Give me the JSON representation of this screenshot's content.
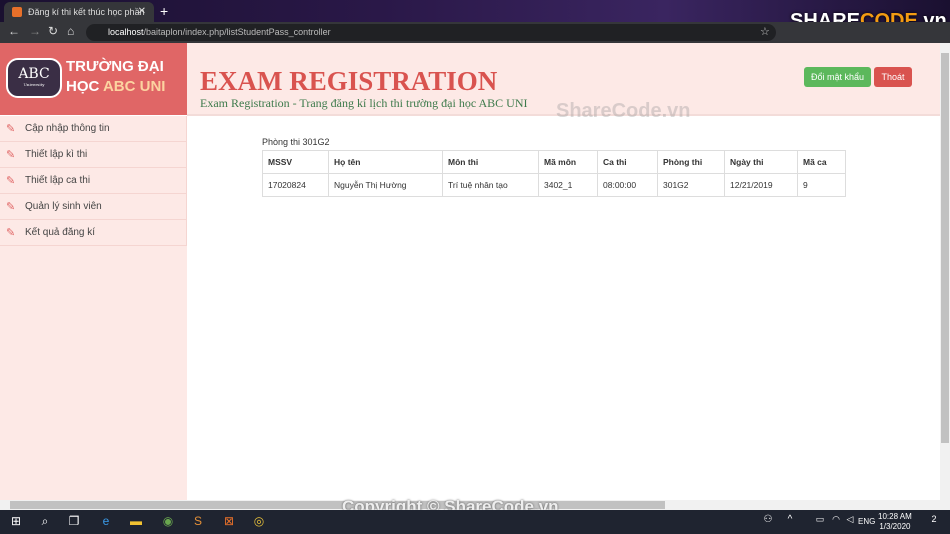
{
  "browser": {
    "tab_title": "Đăng kí thi kết thúc học phần",
    "url_host": "localhost",
    "url_path": "/baitaplon/index.php/listStudentPass_controller"
  },
  "brand": {
    "logo_text": "ABC",
    "logo_sub": "University",
    "line1": "TRƯỜNG ĐẠI",
    "line2a": "HỌC ",
    "line2b": "ABC UNI"
  },
  "header": {
    "title": "EXAM REGISTRATION",
    "subtitle": "Exam Registration - Trang đăng kí lịch thi trường đại học ABC UNI",
    "change_password": "Đổi mật khẩu",
    "logout": "Thoát",
    "colors": {
      "green": "#5cb85c",
      "red": "#d9534f"
    }
  },
  "sidebar": {
    "items": [
      {
        "label": "Cập nhập thông tin"
      },
      {
        "label": "Thiết lập kì thi"
      },
      {
        "label": "Thiết lập ca thi"
      },
      {
        "label": "Quản lý sinh viên"
      },
      {
        "label": "Kết quả đăng kí"
      }
    ]
  },
  "main": {
    "caption": "Phòng thi 301G2",
    "columns": [
      "MSSV",
      "Họ tên",
      "Môn thi",
      "Mã môn",
      "Ca thi",
      "Phòng thi",
      "Ngày thi",
      "Mã ca"
    ],
    "rows": [
      [
        "17020824",
        "Nguyễn Thị Hường",
        "Trí tuệ nhân tạo",
        "3402_1",
        "08:00:00",
        "301G2",
        "12/21/2019",
        "9"
      ]
    ]
  },
  "watermarks": {
    "top": "ShareCode.vn",
    "bottom": "Copyright © ShareCode.vn",
    "logo": "SHARECODE.vn"
  },
  "taskbar": {
    "lang": "ENG",
    "time": "10:28 AM",
    "date": "1/3/2020",
    "notifications": "2"
  }
}
